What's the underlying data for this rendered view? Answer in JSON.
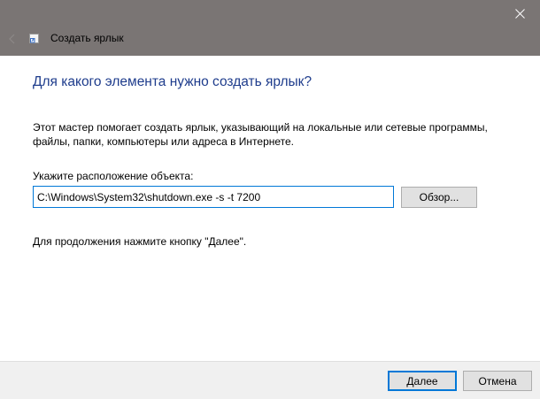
{
  "window": {
    "title": "Создать ярлык",
    "titlebar_color": "#7a7574",
    "close_icon": "close-icon",
    "back_icon": "back-arrow-icon"
  },
  "main": {
    "heading": "Для какого элемента нужно создать ярлык?",
    "heading_color": "#1e3c8c",
    "description": "Этот мастер помогает создать ярлык, указывающий на локальные или сетевые программы, файлы, папки, компьютеры или адреса в Интернете.",
    "location_label": "Укажите расположение объекта:",
    "location_value": "C:\\Windows\\System32\\shutdown.exe -s -t 7200",
    "browse_label": "Обзор...",
    "hint": "Для продолжения нажмите кнопку \"Далее\"."
  },
  "footer": {
    "next_label": "Далее",
    "cancel_label": "Отмена",
    "accent_color": "#0078d7"
  }
}
